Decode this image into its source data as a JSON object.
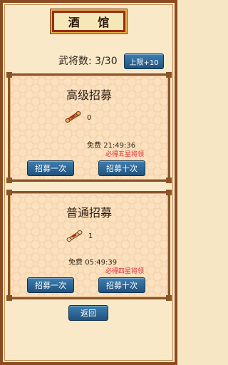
{
  "title": "酒 馆",
  "general_count": {
    "label": "武将数:",
    "value": "3/30"
  },
  "limit_button": "上限+10",
  "panels": [
    {
      "title": "高级招募",
      "item_count": "0",
      "free_label": "免费",
      "timer": "21:49:36",
      "guarantee": "必得五星将领",
      "btn_once": "招募一次",
      "btn_ten": "招募十次"
    },
    {
      "title": "普通招募",
      "item_count": "1",
      "free_label": "免费",
      "timer": "05:49:39",
      "guarantee": "必得四星将领",
      "btn_once": "招募一次",
      "btn_ten": "招募十次"
    }
  ],
  "back_button": "返回",
  "colors": {
    "frame": "#8a4a22",
    "button": "#2c6796",
    "accent_red": "#e02a3a"
  },
  "icons": [
    "scroll-icon"
  ]
}
